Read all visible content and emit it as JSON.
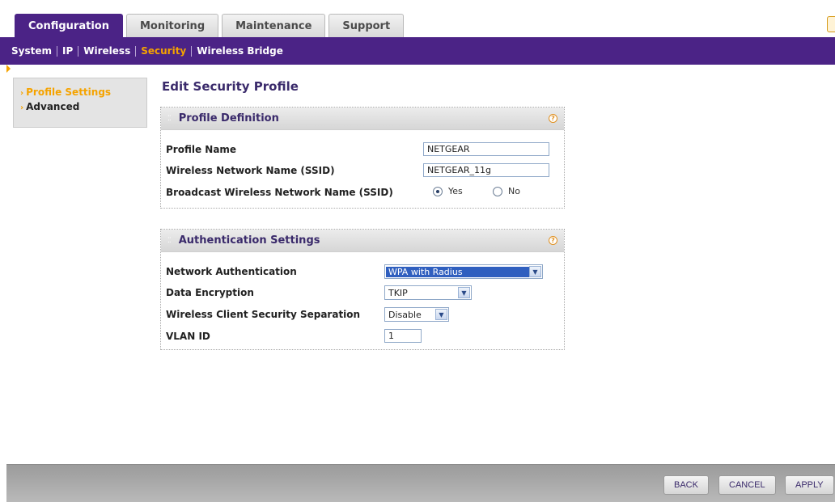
{
  "tabs": [
    {
      "label": "Configuration"
    },
    {
      "label": "Monitoring"
    },
    {
      "label": "Maintenance"
    },
    {
      "label": "Support"
    }
  ],
  "subnav": [
    {
      "label": "System"
    },
    {
      "label": "IP"
    },
    {
      "label": "Wireless"
    },
    {
      "label": "Security"
    },
    {
      "label": "Wireless Bridge"
    }
  ],
  "leftmenu": [
    {
      "label": "Profile Settings"
    },
    {
      "label": "Advanced"
    }
  ],
  "page_title": "Edit Security Profile",
  "profile_definition": {
    "title": "Profile Definition",
    "profile_name_label": "Profile Name",
    "profile_name_value": "NETGEAR",
    "ssid_label": "Wireless Network Name (SSID)",
    "ssid_value": "NETGEAR_11g",
    "broadcast_label": "Broadcast Wireless Network Name (SSID)",
    "yes_label": "Yes",
    "no_label": "No"
  },
  "authentication": {
    "title": "Authentication Settings",
    "network_auth_label": "Network Authentication",
    "network_auth_value": "WPA with Radius",
    "encryption_label": "Data Encryption",
    "encryption_value": "TKIP",
    "separation_label": "Wireless Client Security Separation",
    "separation_value": "Disable",
    "vlan_label": "VLAN ID",
    "vlan_value": "1"
  },
  "buttons": {
    "back": "BACK",
    "cancel": "CANCEL",
    "apply": "APPLY"
  },
  "help_glyph": "?",
  "colors": {
    "nav_purple": "#4b2386",
    "accent_orange": "#f5a300"
  }
}
